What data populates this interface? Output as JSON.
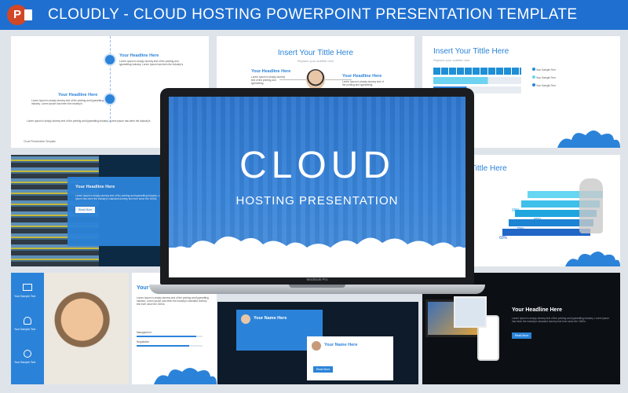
{
  "header": {
    "title": "CLOUDLY - CLOUD HOSTING POWERPOINT PRESENTATION TEMPLATE"
  },
  "laptop": {
    "title": "CLOUD",
    "subtitle": "HOSTING PRESENTATION",
    "brand": "MacBook Pro"
  },
  "slides": {
    "s1": {
      "head1": "Your Headline Here",
      "head2": "Your Headline Here",
      "text": "Lorem Ipsum is simply dummy text of the printing and typesetting industry. Lorem Ipsum has been the industry's",
      "footer": "Cloud   Presentation   Template"
    },
    "s2": {
      "title": "Insert Your Tittle Here",
      "subtitle": "Replace your subtitle here",
      "head_left": "Your Headline Here",
      "head_right": "Your Headline Here",
      "text": "Lorem Ipsum is simply dummy text of the printing and typesetting."
    },
    "s3": {
      "title": "Insert Your Tittle Here",
      "subtitle": "Replace your subtitle here",
      "legend": [
        "Your Sample Text",
        "Your Sample Text",
        "Your Sample Text"
      ]
    },
    "s4": {
      "head": "Your Headline Here",
      "text": "Lorem Ipsum is simply dummy text of the printing and typesetting industry. Lorem Ipsum has been the industry's standard dummy text ever since the 1500s.",
      "button": "Read More"
    },
    "s5": {
      "title_fragment": "r Tittle Here",
      "percents": [
        "90%",
        "80%",
        "70%",
        "60%"
      ]
    },
    "s6": {
      "items": [
        "Your Sample Text",
        "Your Sample Text",
        "Your Sample Text"
      ]
    },
    "s7": {
      "head_fragment": "Your Headline H",
      "bars": [
        {
          "label": "Management",
          "value": 0.9
        },
        {
          "label": "Negotiation",
          "value": 0.8
        }
      ]
    },
    "s8": {
      "name1": "Your Name Here",
      "name2": "Your Name Here",
      "button": "Read More"
    },
    "s9": {
      "head": "Your Headline Here",
      "button": "Read More"
    }
  }
}
